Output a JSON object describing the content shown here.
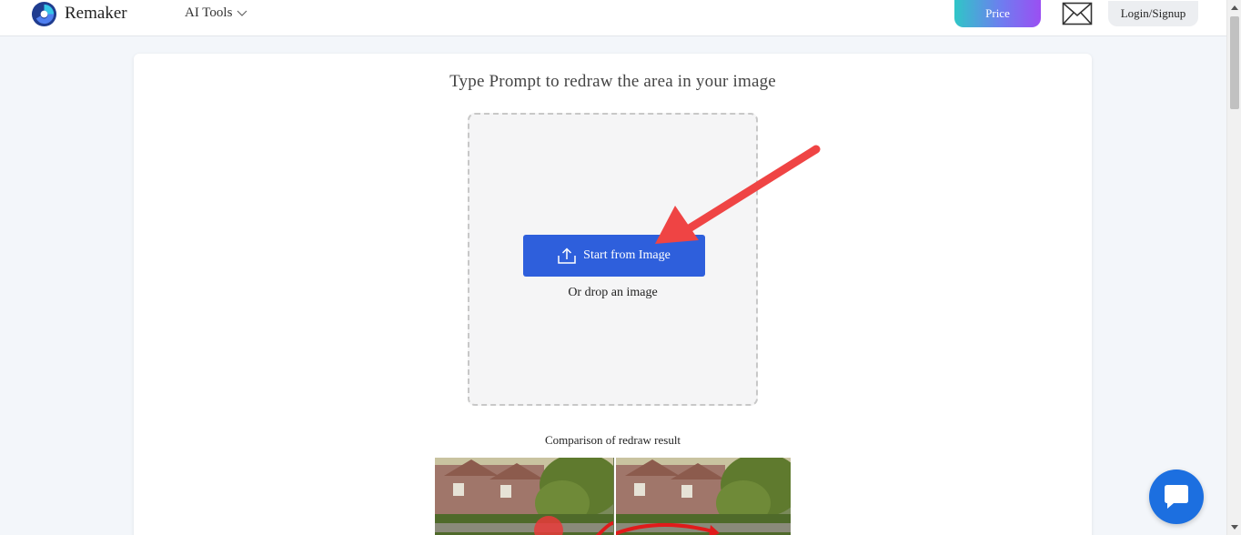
{
  "header": {
    "brand": "Remaker",
    "nav_ai_tools": "AI Tools",
    "price_label": "Price",
    "login_label": "Login/Signup"
  },
  "main": {
    "title": "Type Prompt to redraw the area in your image",
    "upload_button_label": "Start from Image",
    "drop_text": "Or drop an image",
    "comparison_label": "Comparison of redraw result"
  },
  "icons": {
    "logo": "remaker-logo-icon",
    "nav_chevron": "chevron-down-icon",
    "mail": "mail-icon",
    "upload": "upload-icon",
    "chat": "chat-bubble-icon",
    "annotation": "red-arrow-annotation"
  },
  "colors": {
    "primary_button": "#2e5fdc",
    "price_gradient_start": "#2fc6c7",
    "price_gradient_end": "#9b4ff2",
    "annotation_arrow": "#ef4444",
    "chat_button": "#1c6fe0"
  }
}
